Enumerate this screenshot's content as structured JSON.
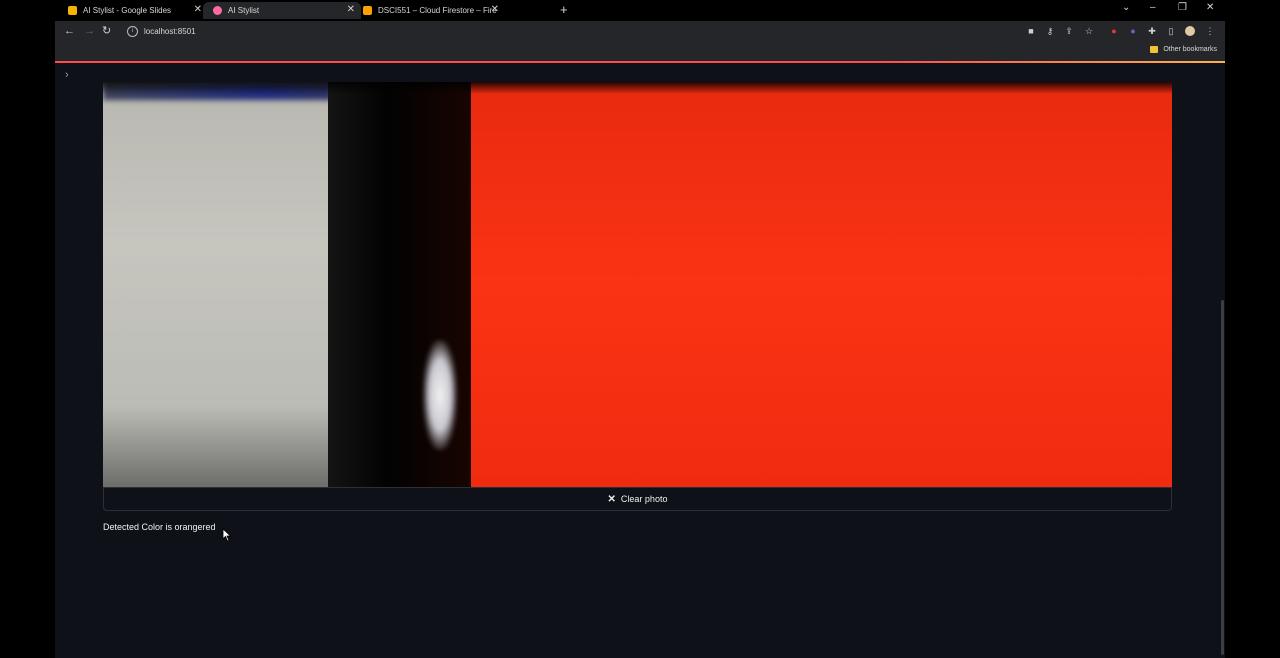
{
  "browser": {
    "tabs": [
      {
        "title": "AI Stylist - Google Slides",
        "favicon_color": "#f4b400",
        "active": false
      },
      {
        "title": "AI Stylist",
        "favicon_color": "#ff6aa0",
        "active": true
      },
      {
        "title": "DSCI551 – Cloud Firestore – Fire",
        "favicon_color": "#ffa000",
        "active": false
      }
    ],
    "new_tab": "+",
    "url": "localhost:8501",
    "bookmarks": {
      "other_label": "Other bookmarks"
    }
  },
  "app": {
    "clear_button_label": "Clear photo",
    "result_text": "Detected Color is orangered"
  },
  "colors": {
    "accent": "#ff4b4b",
    "app_bg": "#0e1117",
    "detected": "#ff3513"
  }
}
